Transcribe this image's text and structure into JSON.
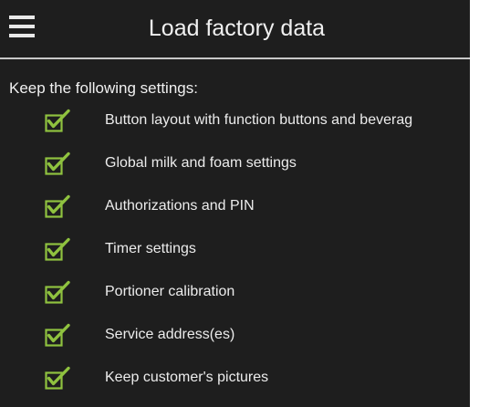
{
  "header": {
    "title": "Load factory data",
    "menu_icon": "hamburger-menu-icon"
  },
  "settings": {
    "heading": "Keep the following settings:",
    "checkbox_icon": "checked-checkbox-icon",
    "checkbox_color": "#8fc23f",
    "items": [
      {
        "label": "Button layout with function buttons and beverag",
        "checked": true
      },
      {
        "label": "Global milk and foam settings",
        "checked": true
      },
      {
        "label": "Authorizations and PIN",
        "checked": true
      },
      {
        "label": "Timer settings",
        "checked": true
      },
      {
        "label": "Portioner calibration",
        "checked": true
      },
      {
        "label": "Service address(es)",
        "checked": true
      },
      {
        "label": "Keep customer's pictures",
        "checked": true
      }
    ]
  }
}
